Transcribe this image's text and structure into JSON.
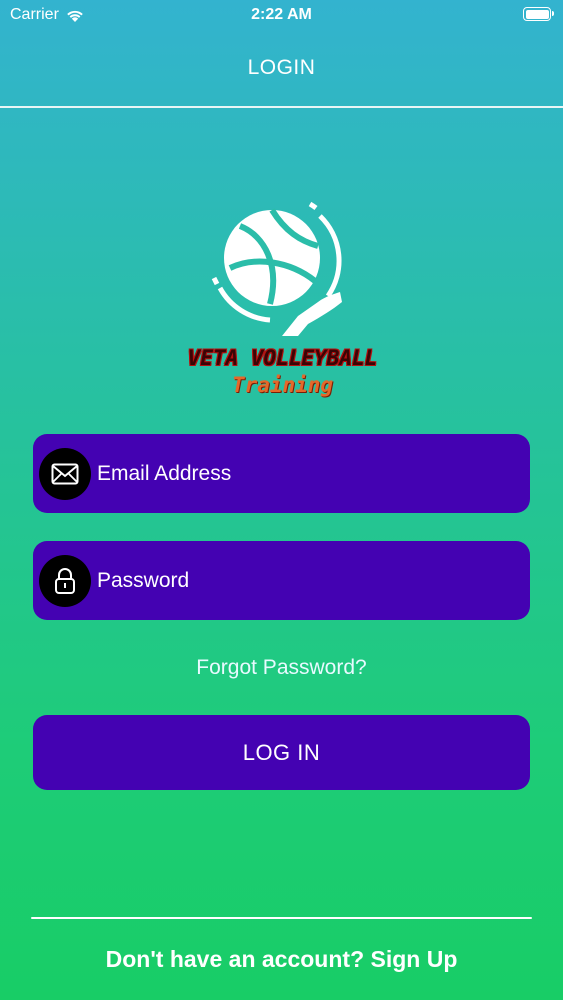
{
  "status_bar": {
    "carrier": "Carrier",
    "time": "2:22 AM"
  },
  "nav": {
    "title": "LOGIN"
  },
  "logo": {
    "line1": "VETA VOLLEYBALL",
    "line2": "Training"
  },
  "form": {
    "email_placeholder": "Email Address",
    "password_placeholder": "Password",
    "forgot_label": "Forgot Password?",
    "login_label": "LOG IN"
  },
  "footer": {
    "signup_label": "Don't have an account? Sign Up"
  },
  "colors": {
    "field_bg": "#4402b2",
    "gradient_top": "#33b3cf",
    "gradient_bottom": "#18cd66"
  }
}
